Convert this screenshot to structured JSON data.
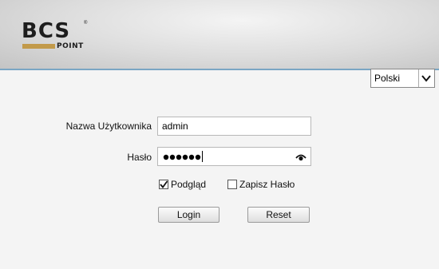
{
  "header": {
    "logo_main": "BCS",
    "logo_sub": "POINT",
    "logo_mark": "®",
    "accent_color": "#c29a4a",
    "line_color": "#7aa6c4"
  },
  "language": {
    "selected": "Polski",
    "icon": "chevron-down-icon"
  },
  "form": {
    "username_label": "Nazwa Użytkownika",
    "username_value": "admin",
    "password_label": "Hasło",
    "password_masked": "••••••",
    "show_password_icon": "eye-icon",
    "preview_label": "Podgląd",
    "preview_checked": true,
    "save_password_label": "Zapisz Hasło",
    "save_password_checked": false,
    "login_label": "Login",
    "reset_label": "Reset"
  }
}
